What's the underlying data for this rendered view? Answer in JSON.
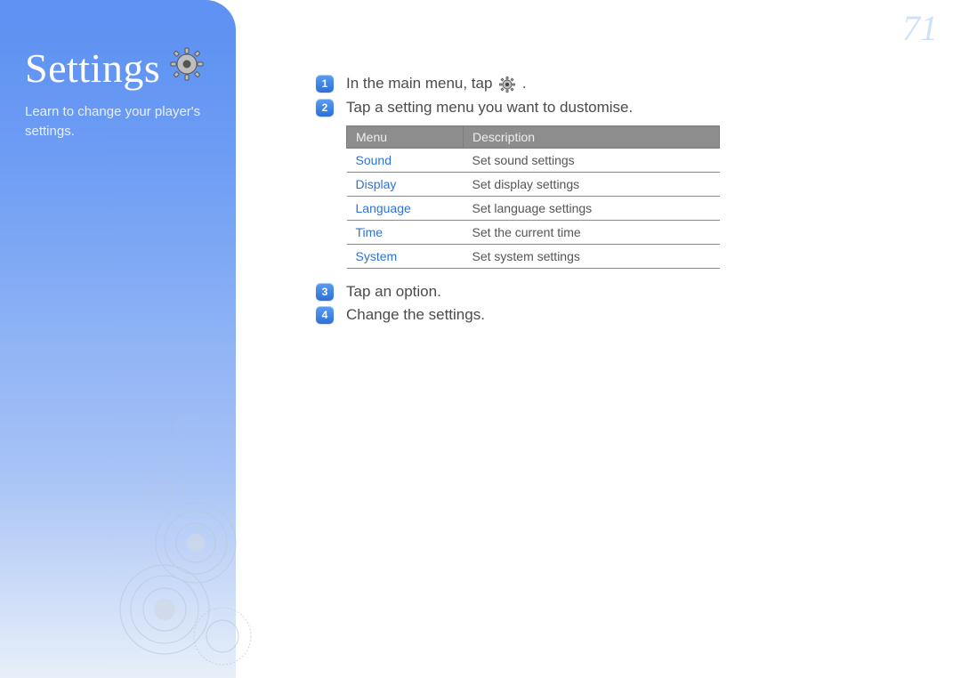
{
  "page_number": "71",
  "sidebar": {
    "title": "Settings",
    "subtitle": "Learn to change your player's settings."
  },
  "steps": {
    "s1_pre": "In the main menu, tap ",
    "s1_post": ".",
    "s2": "Tap a setting menu you want to dustomise.",
    "s3": "Tap an option.",
    "s4": "Change the settings."
  },
  "table": {
    "head_menu": "Menu",
    "head_desc": "Description",
    "rows": [
      {
        "menu": "Sound",
        "desc": "Set sound settings"
      },
      {
        "menu": "Display",
        "desc": "Set display settings"
      },
      {
        "menu": "Language",
        "desc": "Set language settings"
      },
      {
        "menu": "Time",
        "desc": "Set the current time"
      },
      {
        "menu": "System",
        "desc": "Set system settings"
      }
    ]
  }
}
